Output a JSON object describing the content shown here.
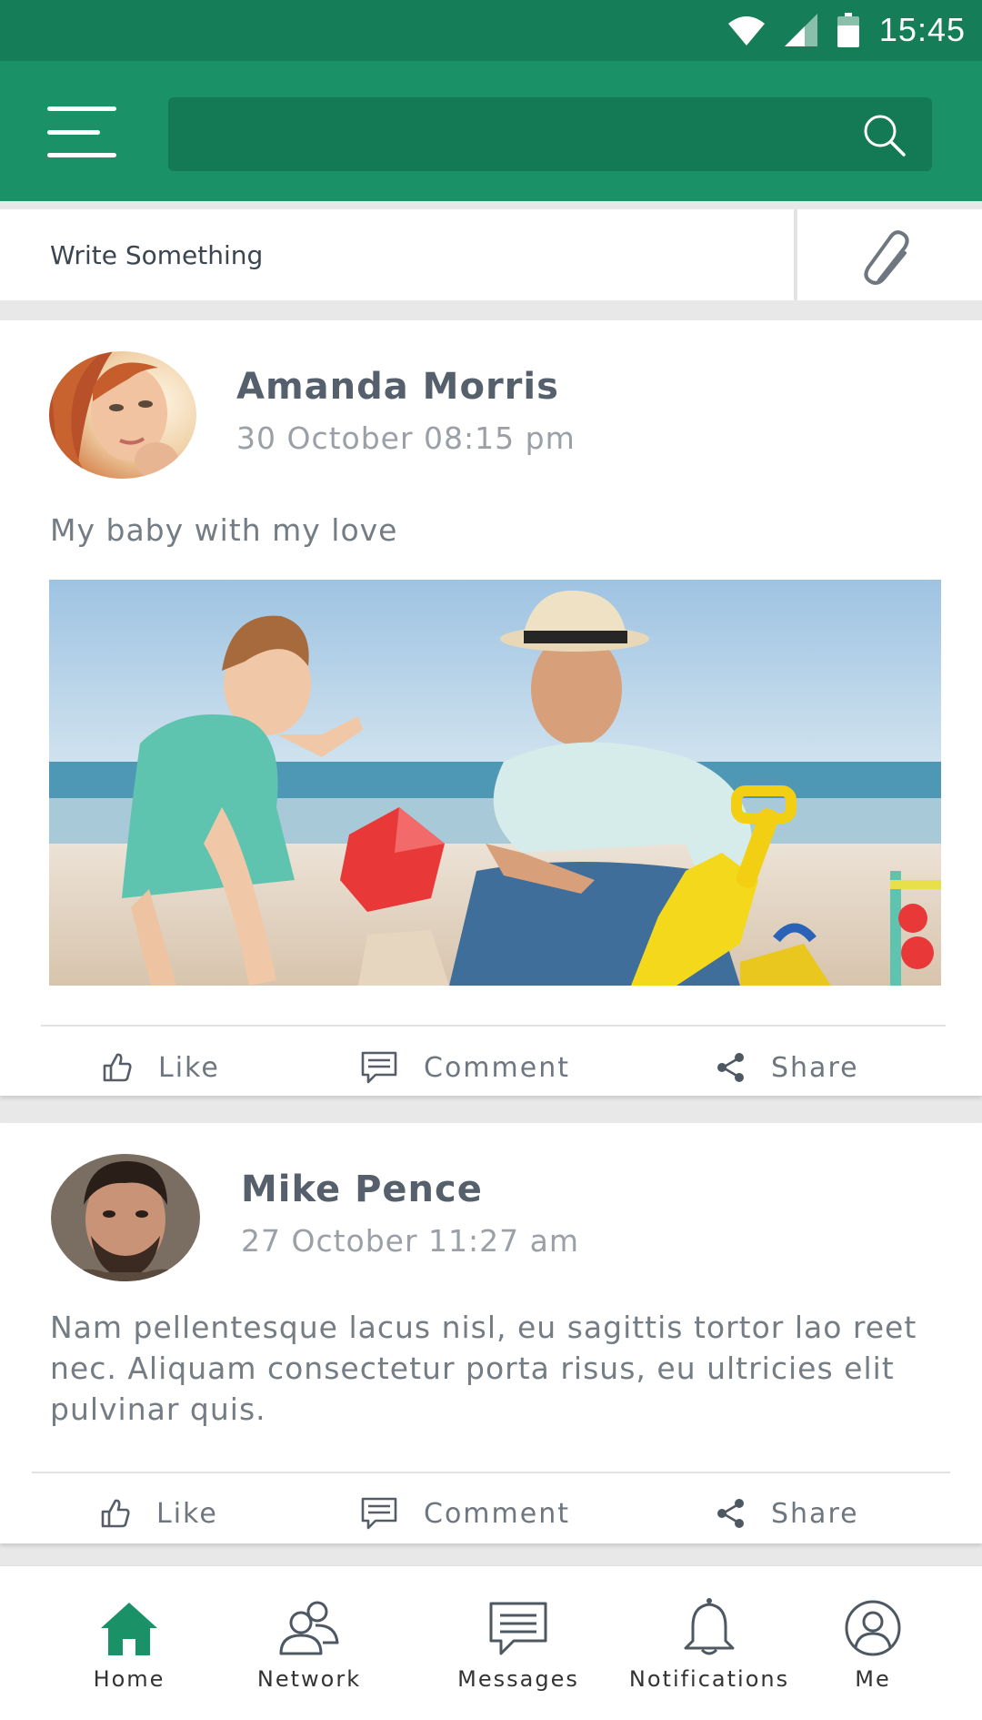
{
  "status_bar": {
    "time": "15:45"
  },
  "search": {
    "placeholder": ""
  },
  "composer": {
    "placeholder": "Write Something"
  },
  "posts": [
    {
      "author": "Amanda Morris",
      "time": "30 October 08:15 pm",
      "text": "My baby with my love",
      "like_label": "Like",
      "comment_label": "Comment",
      "share_label": "Share"
    },
    {
      "author": "Mike Pence",
      "time": "27 October 11:27 am",
      "text": "Nam pellentesque lacus nisl, eu sagittis tortor lao reet nec. Aliquam consectetur porta risus, eu ultricies elit pulvinar quis.",
      "like_label": "Like",
      "comment_label": "Comment",
      "share_label": "Share"
    }
  ],
  "bottom_nav": {
    "items": [
      {
        "label": "Home",
        "icon": "home-icon",
        "active": true
      },
      {
        "label": "Network",
        "icon": "network-icon",
        "active": false
      },
      {
        "label": "Messages",
        "icon": "messages-icon",
        "active": false
      },
      {
        "label": "Notifications",
        "icon": "bell-icon",
        "active": false
      },
      {
        "label": "Me",
        "icon": "profile-icon",
        "active": false
      }
    ]
  },
  "colors": {
    "status_bar": "#157e58",
    "app_bar": "#1a9166",
    "search_box": "#137a55",
    "accent": "#1a9166"
  }
}
